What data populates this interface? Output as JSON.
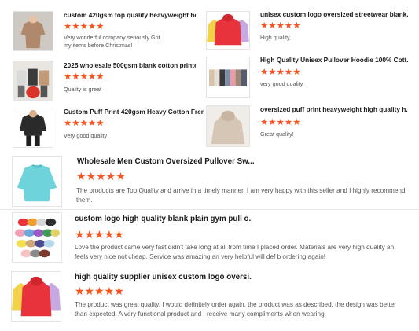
{
  "reviews_small": [
    {
      "title": "custom 420gsm top quality heavyweight hoodi...",
      "stars": "★★★★★",
      "text": "Very wonderful company seriously Got my items before Christmas!"
    },
    {
      "title": "unisex custom logo oversized streetwear blank...",
      "stars": "★★★★★",
      "text": "High quality,"
    },
    {
      "title": "2025 wholesale 500gsm blank cotton printed h...",
      "stars": "★★★★★",
      "text": "Quality is great"
    },
    {
      "title": "High Quality Unisex Pullover Hoodie 100% Cott...",
      "stars": "★★★★★",
      "text": "very good quality"
    },
    {
      "title": "Custom Puff Print 420gsm Heavy Cotton Frenc...",
      "stars": "★★★★★",
      "text": "Very good quality"
    },
    {
      "title": "oversized puff print heavyweight high quality h...",
      "stars": "★★★★★",
      "text": "Great quality!"
    }
  ],
  "reviews_large": [
    {
      "title": "Wholesale Men Custom Oversized Pullover Sw...",
      "stars": "★★★★★",
      "text": "The products are Top Quality and arrive in a timely manner.  I am very happy with this seller and I highly recommend them."
    },
    {
      "title": "custom logo high quality blank plain gym pull o...",
      "stars": "★★★★★",
      "text": "Love the product came very fast didn't take long at all from time I placed order. Materials are very high quality an feels very nice not cheap. Service was amazing an very helpful will def b ordering again!"
    },
    {
      "title": "high quality supplier unisex custom logo oversi...",
      "stars": "★★★★★",
      "text": "The product was great quality, I would definitely order again, the product was as described, the design was better than expected. A very functional product and I receive many compliments when wearing"
    }
  ],
  "colors": {
    "star": "#f7541f",
    "title": "#1a1a1a",
    "text": "#555555"
  }
}
